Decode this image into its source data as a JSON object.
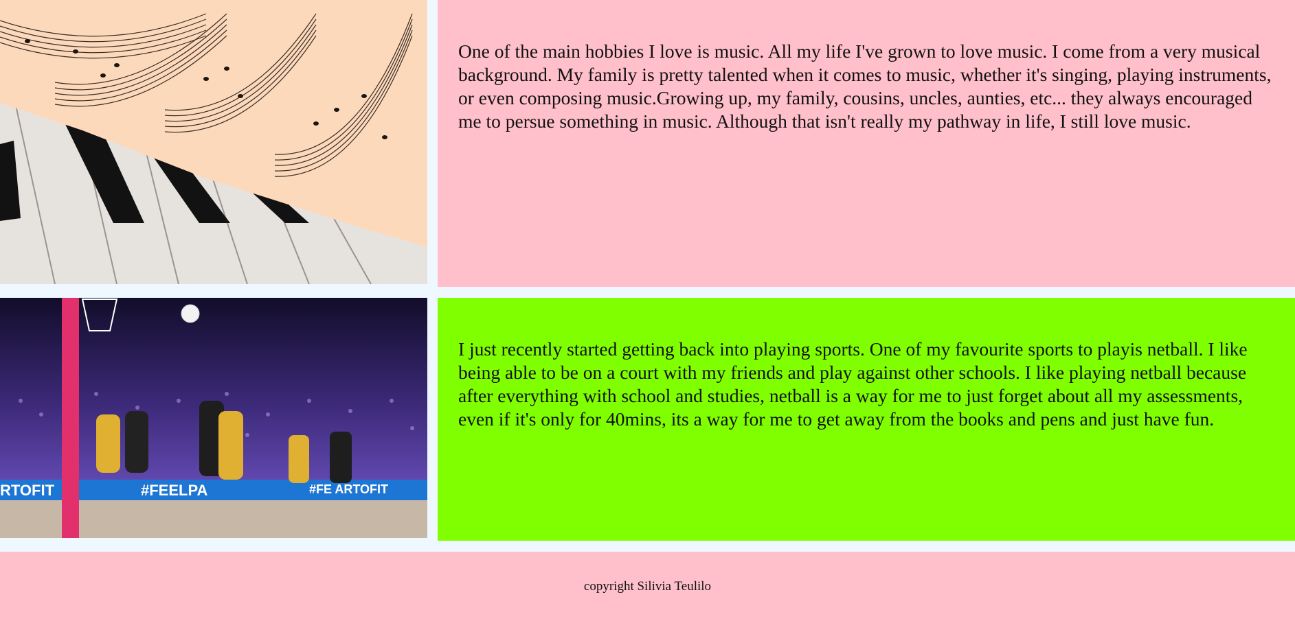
{
  "sections": {
    "music": {
      "image_alt": "Sheet music resting on piano keys",
      "text": "One of the main hobbies I love is music. All my life I've grown to love music. I come from a very musical background. My family is pretty talented when it comes to music, whether it's singing, playing instruments, or even composing music.Growing up, my family, cousins, uncles, aunties, etc... they always encouraged me to persue something in music. Although that isn't really my pathway in life, I still love music.",
      "bg_color": "#ffc0cb"
    },
    "netball": {
      "image_alt": "Netball players on an indoor court",
      "banner_texts": [
        "RTOFIT",
        "#FEELPA",
        "#FE  ARTOFIT"
      ],
      "text": "I just recently started getting back into playing sports. One of my favourite sports to playis netball. I like being able to be on a court with my friends and play against other schools. I like playing netball because after everything with school and studies, netball is a way for me to just forget about all my assessments, even if it's only for 40mins, its a way for me to get away from the books and pens and just have fun.",
      "bg_color": "#80ff00"
    }
  },
  "footer": {
    "copyright": "copyright Silivia Teulilo",
    "bg_color": "#ffc0cb"
  }
}
